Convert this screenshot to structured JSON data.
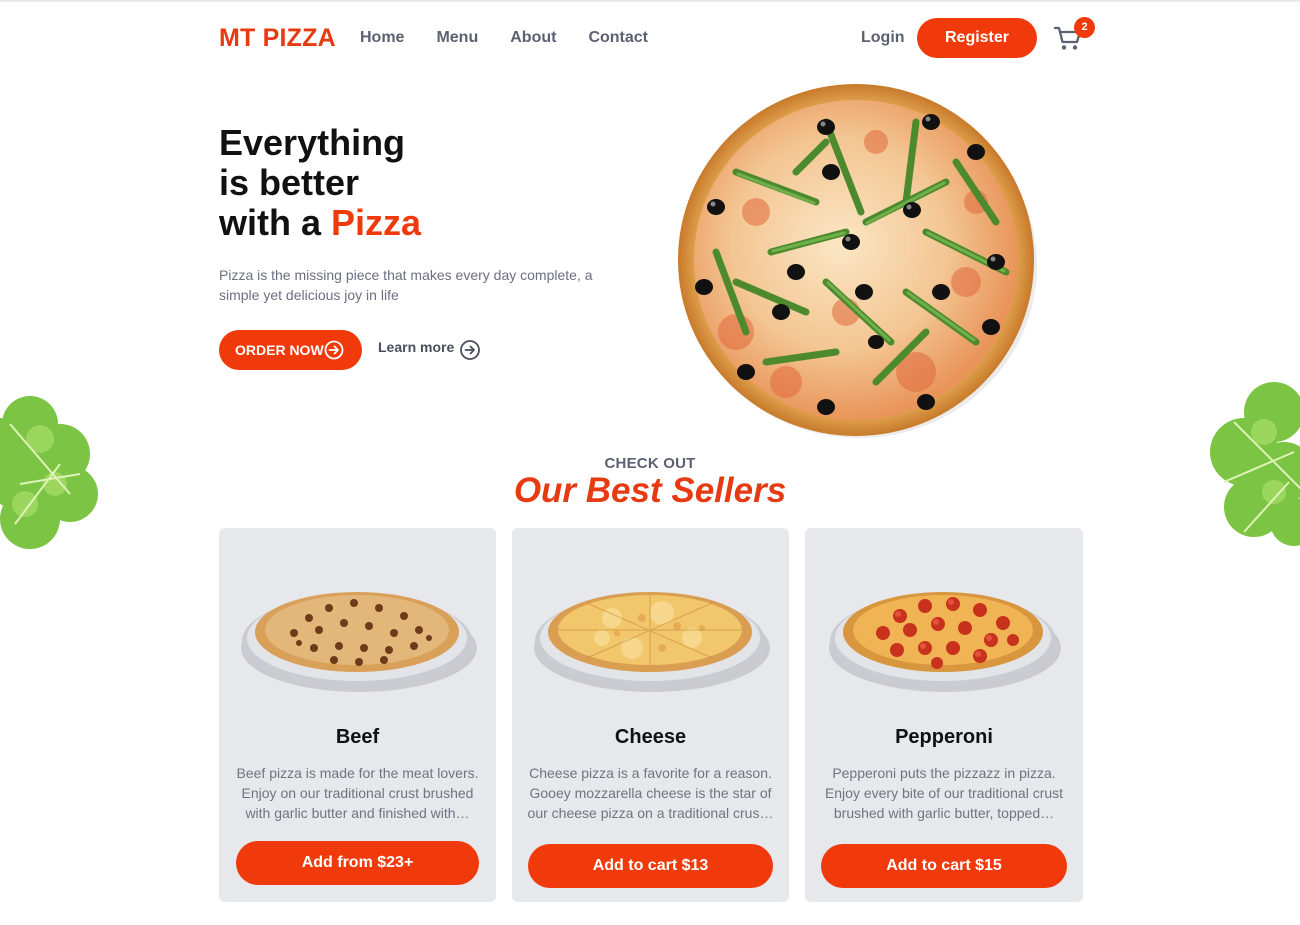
{
  "brand": {
    "name": "MT PIZZA",
    "color": "#e63a12"
  },
  "nav": {
    "links": [
      "Home",
      "Menu",
      "About",
      "Contact"
    ],
    "login_label": "Login",
    "register_label": "Register",
    "cart_count": "2"
  },
  "hero": {
    "title_line1": "Everything",
    "title_line2": "is better",
    "title_line3_prefix": "with a ",
    "title_line3_accent": "Pizza",
    "description": "Pizza is the missing piece that makes every day complete, a simple yet delicious joy in life",
    "order_label": "ORDER NOW",
    "learn_label": "Learn more"
  },
  "best_sellers": {
    "kicker": "CHECK OUT",
    "title": "Our Best Sellers",
    "items": [
      {
        "name": "Beef",
        "description": "Beef pizza is made for the meat lovers. Enjoy on our traditional crust brushed with garlic butter and finished with…",
        "button": "Add from $23+",
        "topping": "beef"
      },
      {
        "name": "Cheese",
        "description": "Cheese pizza is a favorite for a reason. Gooey mozzarella cheese is the star of our cheese pizza on a traditional crus…",
        "button": "Add to cart $13",
        "topping": "cheese"
      },
      {
        "name": "Pepperoni",
        "description": "Pepperoni puts the pizzazz in pizza. Enjoy every bite of our traditional crust brushed with garlic butter, topped…",
        "button": "Add to cart $15",
        "topping": "pepperoni"
      }
    ]
  },
  "colors": {
    "accent": "#f03a0b",
    "card_bg": "#e7e8ec",
    "muted_text": "#6b7080"
  }
}
